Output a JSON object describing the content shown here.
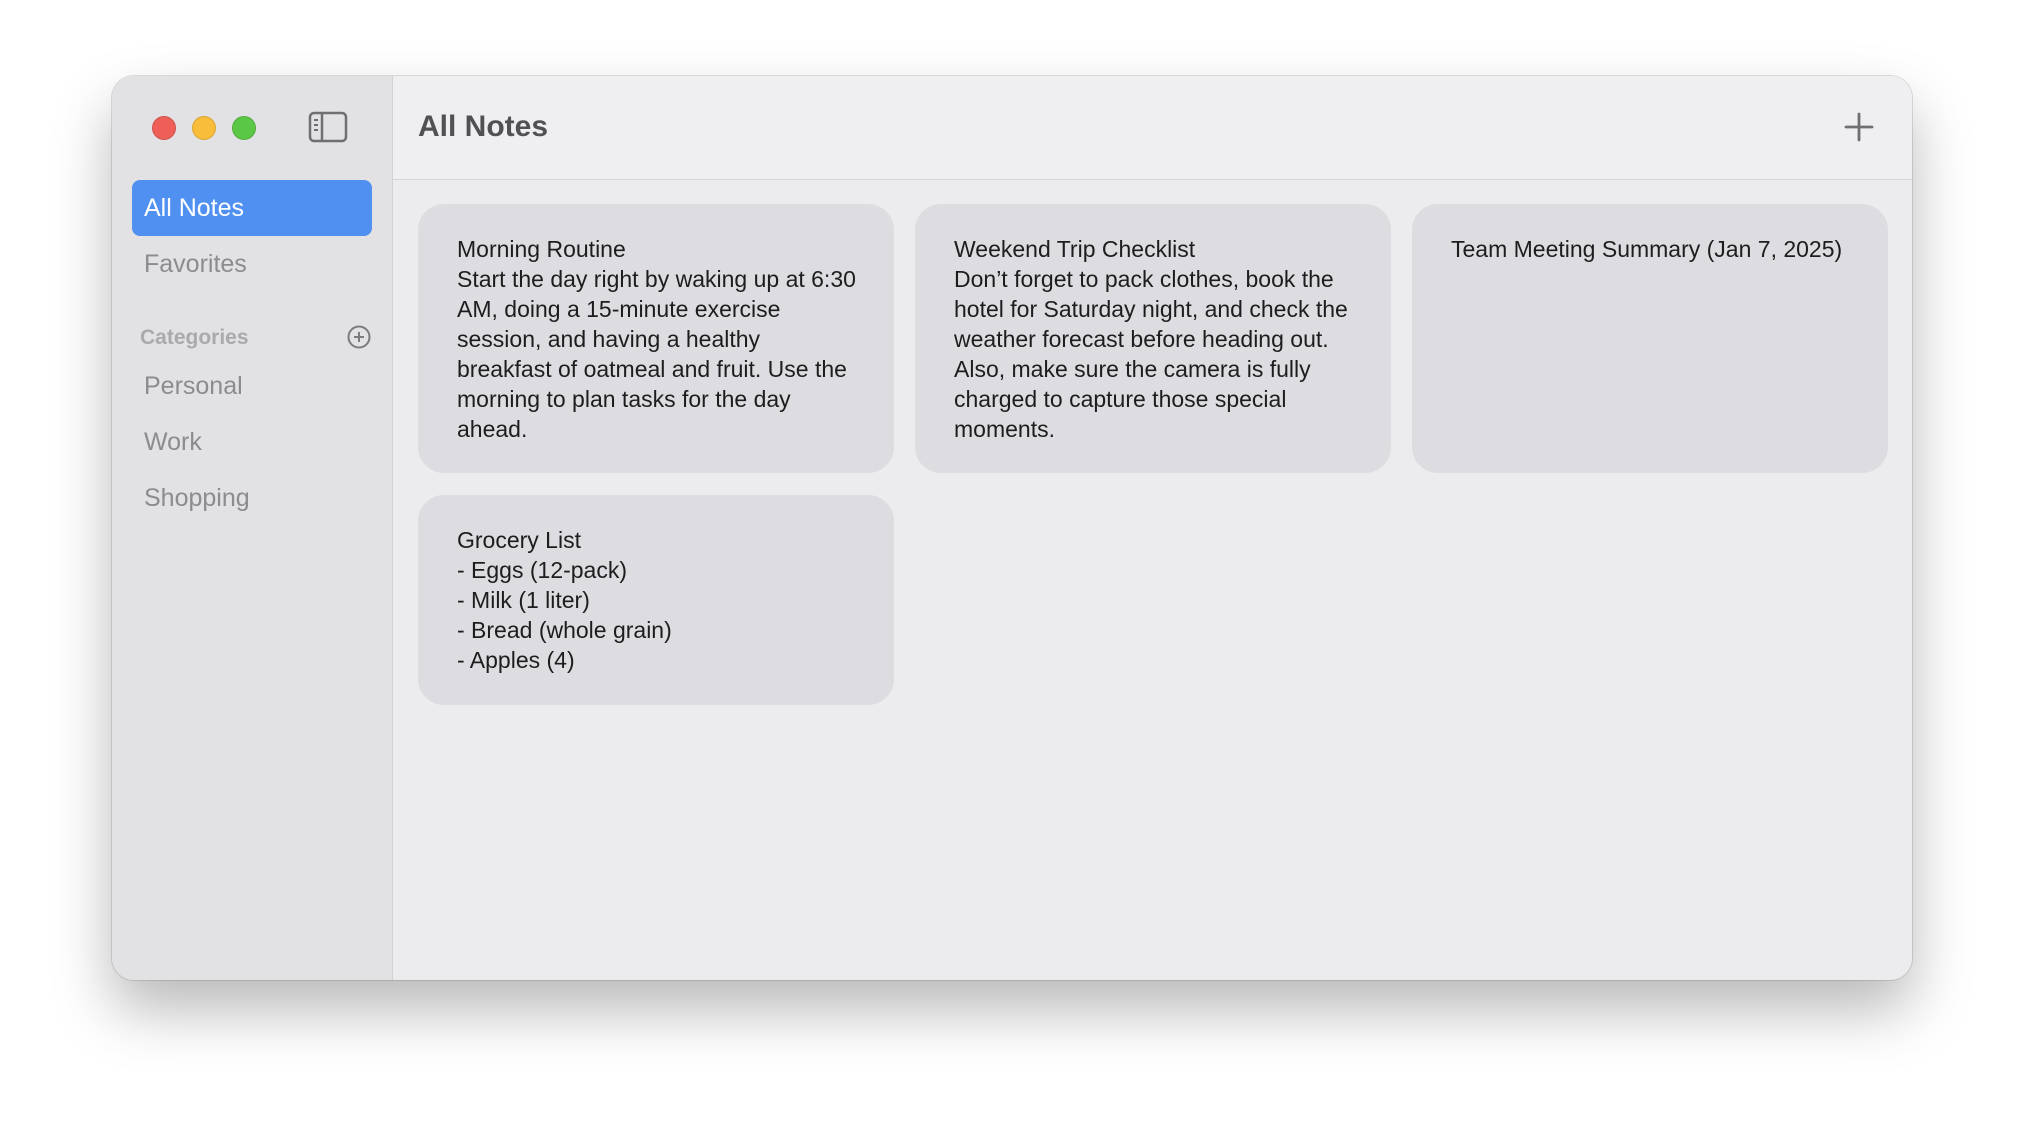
{
  "sidebar": {
    "items": [
      {
        "label": "All Notes",
        "active": true
      },
      {
        "label": "Favorites",
        "active": false
      }
    ],
    "categories_title": "Categories",
    "categories": [
      {
        "label": "Personal"
      },
      {
        "label": "Work"
      },
      {
        "label": "Shopping"
      }
    ]
  },
  "header": {
    "title": "All Notes"
  },
  "notes": [
    {
      "title": "Morning Routine",
      "body": "Start the day right by waking up at 6:30 AM, doing a 15-minute exercise session, and having a healthy breakfast of oatmeal and fruit. Use the morning to plan tasks for the day ahead."
    },
    {
      "title": "Weekend Trip Checklist",
      "body": "Don’t forget to pack clothes, book the hotel for Saturday night, and check the weather forecast before heading out. Also, make sure the camera is fully charged to capture those special moments."
    },
    {
      "title": "Team Meeting Summary (Jan 7, 2025)",
      "body": ""
    },
    {
      "title": "Grocery List",
      "body": "- Eggs (12-pack)\n- Milk (1 liter)\n- Bread (whole grain)\n- Apples (4)"
    }
  ],
  "icons": {
    "close": "close-window-icon",
    "minimize": "minimize-window-icon",
    "zoom": "zoom-window-icon",
    "sidebar_toggle": "sidebar-toggle-icon",
    "add_category": "plus-circle-icon",
    "add_note": "plus-icon"
  },
  "colors": {
    "accent": "#5090f0",
    "close": "#ee5f58",
    "minimize": "#f8bd3a",
    "zoom": "#5bc747",
    "card": "#dddde1",
    "sidebar": "#e2e2e5"
  }
}
